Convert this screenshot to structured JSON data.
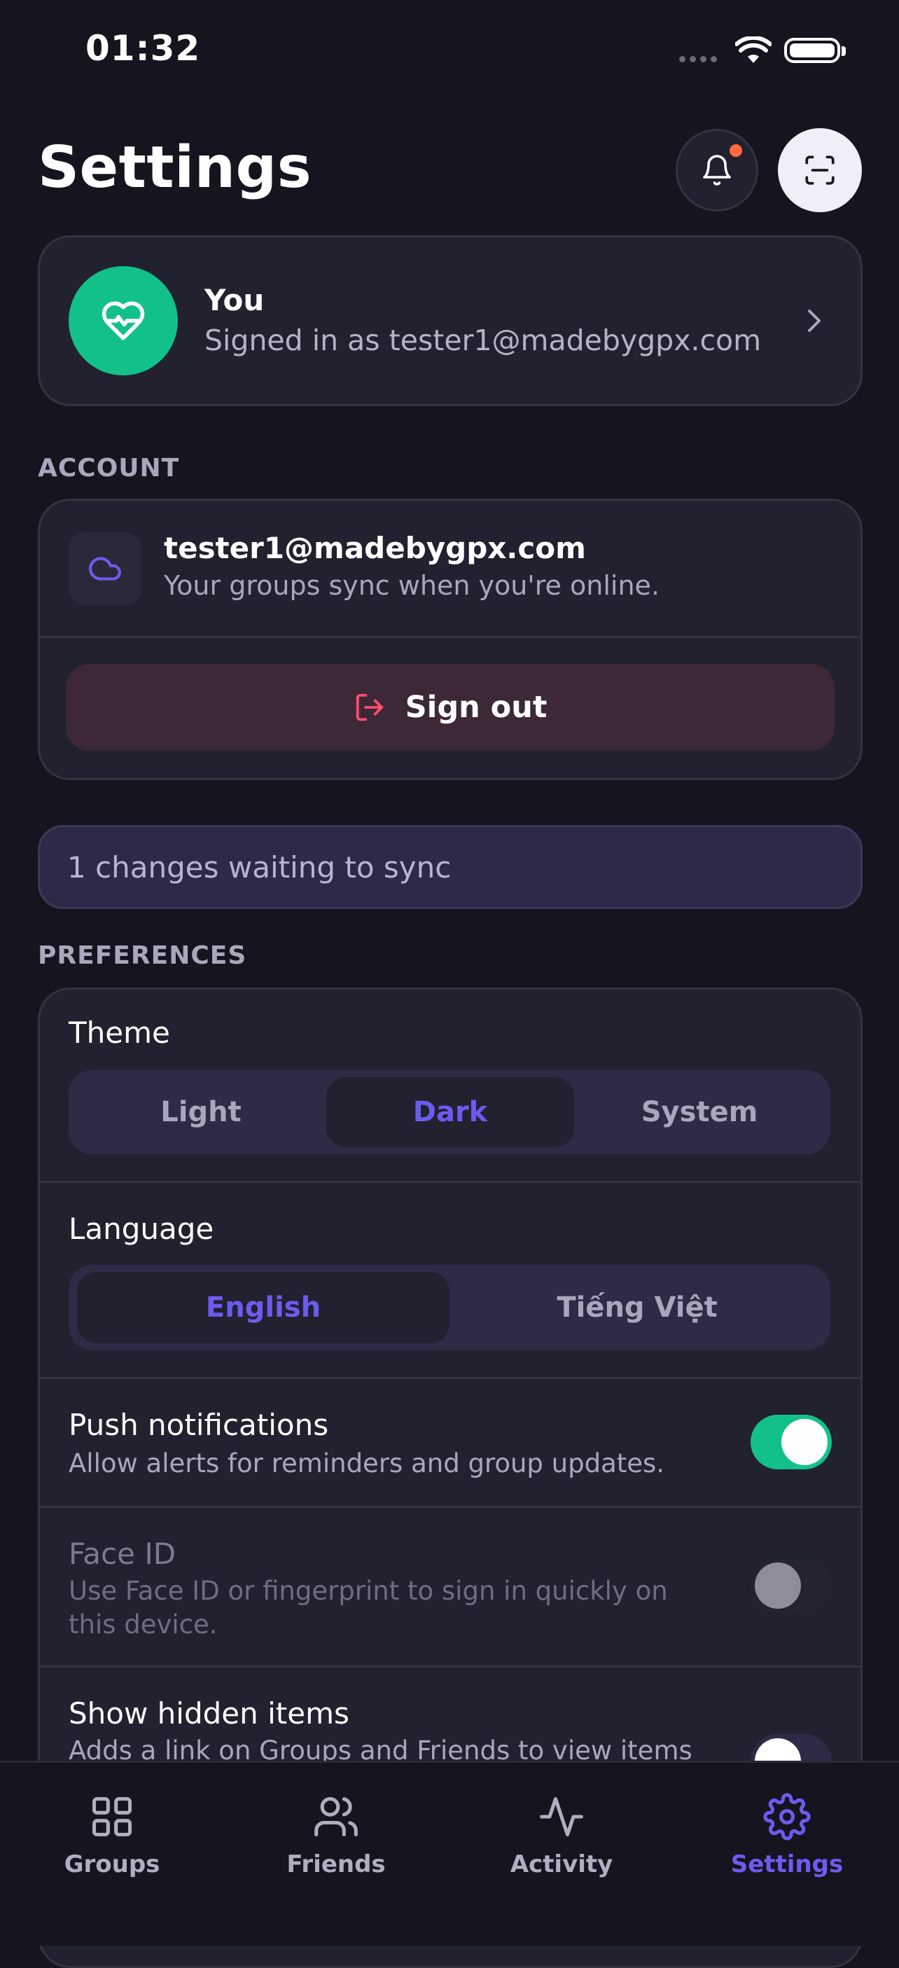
{
  "status_bar": {
    "time": "01:32"
  },
  "header": {
    "title": "Settings"
  },
  "profile": {
    "name": "You",
    "subtitle": "Signed in as tester1@madebygpx.com"
  },
  "account": {
    "section_label": "ACCOUNT",
    "email": "tester1@madebygpx.com",
    "sync_note": "Your groups sync when you're online.",
    "sign_out_label": "Sign out"
  },
  "sync_banner": {
    "text": "1 changes waiting to sync"
  },
  "preferences": {
    "section_label": "PREFERENCES",
    "theme": {
      "label": "Theme",
      "options": [
        "Light",
        "Dark",
        "System"
      ],
      "selected": "Dark"
    },
    "language": {
      "label": "Language",
      "options": [
        "English",
        "Tiếng Việt"
      ],
      "selected": "English"
    },
    "push": {
      "title": "Push notifications",
      "subtitle": "Allow alerts for reminders and group updates.",
      "enabled": true
    },
    "face_id": {
      "title": "Face ID",
      "subtitle": "Use Face ID or fingerprint to sign in quickly on this device.",
      "enabled": false
    },
    "hidden_items": {
      "title": "Show hidden items",
      "subtitle": "Adds a link on Groups and Friends to view items"
    }
  },
  "tabs": [
    {
      "label": "Groups",
      "icon": "grid-icon"
    },
    {
      "label": "Friends",
      "icon": "users-icon"
    },
    {
      "label": "Activity",
      "icon": "activity-icon"
    },
    {
      "label": "Settings",
      "icon": "gear-icon",
      "active": true
    }
  ],
  "colors": {
    "accent": "#6b5cf0",
    "success": "#12c189",
    "danger": "#ff4d6d",
    "background": "#15141f"
  }
}
